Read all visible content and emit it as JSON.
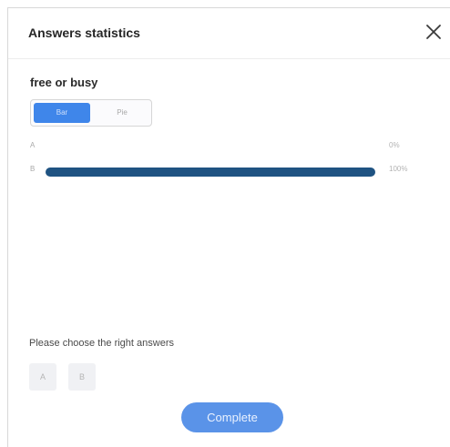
{
  "dialog": {
    "title": "Answers statistics",
    "close_icon": "close-icon"
  },
  "question": {
    "title": "free or busy"
  },
  "view_toggle": {
    "options": [
      "Bar",
      "Pie"
    ],
    "selected": "Bar",
    "active_color": "#3f86ea"
  },
  "chart_data": {
    "type": "bar",
    "categories": [
      "A",
      "B"
    ],
    "values": [
      0,
      100
    ],
    "value_labels": [
      "0%",
      "100%"
    ],
    "bar_color": "#1f5382"
  },
  "answer_picker": {
    "prompt": "Please choose the right answers",
    "options": [
      "A",
      "B"
    ]
  },
  "footer": {
    "complete_label": "Complete",
    "button_color": "#5a93e8"
  }
}
